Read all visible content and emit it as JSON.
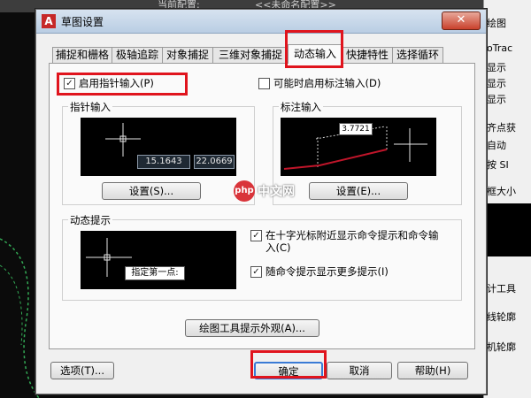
{
  "background": {
    "top_text": "当前配置:",
    "top_profile": "<<未命名配置>>",
    "right_panel_items": [
      "绘图",
      "oTrac",
      "显示",
      "显示",
      "显示",
      "齐点获",
      "自动",
      "按 SI",
      "框大小",
      "计工具",
      "线轮廓",
      "机轮廓"
    ]
  },
  "dialog": {
    "title": "草图设置",
    "close_glyph": "✕",
    "tabs": [
      "捕捉和栅格",
      "极轴追踪",
      "对象捕捉",
      "三维对象捕捉",
      "动态输入",
      "快捷特性",
      "选择循环"
    ],
    "enable_pointer_input": {
      "label": "启用指针输入(P)",
      "checked": true
    },
    "enable_dimension_input": {
      "label": "可能时启用标注输入(D)",
      "checked": false
    },
    "pointer_input": {
      "legend": "指针输入",
      "values": [
        "15.1643",
        "22.0669"
      ],
      "settings_button": "设置(S)..."
    },
    "dimension_input": {
      "legend": "标注输入",
      "value": "3.7721",
      "settings_button": "设置(E)..."
    },
    "dynamic_prompts": {
      "legend": "动态提示",
      "prompt_text": "指定第一点:",
      "show_near_crosshair": {
        "label": "在十字光标附近显示命令提示和命令输入(C)",
        "checked": true
      },
      "show_more_prompts": {
        "label": "随命令提示显示更多提示(I)",
        "checked": true
      }
    },
    "tooltip_appearance_button": "绘图工具提示外观(A)...",
    "footer": {
      "options_button": "选项(T)...",
      "ok_button": "确定",
      "cancel_button": "取消",
      "help_button": "帮助(H)"
    },
    "colors": {
      "highlight": "#e0141d",
      "preview_bg": "#000000",
      "input_box": "#1f2933"
    }
  },
  "watermark": {
    "logo_text": "php",
    "text": "中文网"
  }
}
